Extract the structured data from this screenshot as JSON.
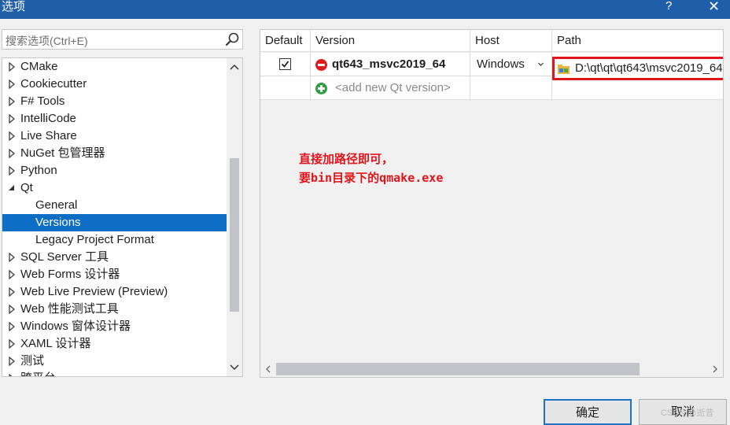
{
  "window": {
    "title": "选项",
    "help": "?",
    "close": "✕"
  },
  "search": {
    "placeholder": "搜索选项(Ctrl+E)"
  },
  "tree": {
    "items": [
      {
        "label": "CMake",
        "expanded": false
      },
      {
        "label": "Cookiecutter",
        "expanded": false
      },
      {
        "label": "F# Tools",
        "expanded": false
      },
      {
        "label": "IntelliCode",
        "expanded": false
      },
      {
        "label": "Live Share",
        "expanded": false
      },
      {
        "label": "NuGet 包管理器",
        "expanded": false
      },
      {
        "label": "Python",
        "expanded": false
      },
      {
        "label": "Qt",
        "expanded": true
      },
      {
        "label": "General",
        "child": true
      },
      {
        "label": "Versions",
        "child": true,
        "selected": true
      },
      {
        "label": "Legacy Project Format",
        "child": true
      },
      {
        "label": "SQL Server 工具",
        "expanded": false
      },
      {
        "label": "Web Forms 设计器",
        "expanded": false
      },
      {
        "label": "Web Live Preview (Preview)",
        "expanded": false
      },
      {
        "label": "Web 性能测试工具",
        "expanded": false
      },
      {
        "label": "Windows 窗体设计器",
        "expanded": false
      },
      {
        "label": "XAML 设计器",
        "expanded": false
      },
      {
        "label": "测试",
        "expanded": false
      },
      {
        "label": "跨平台",
        "expanded": false
      }
    ]
  },
  "grid": {
    "headers": {
      "default": "Default",
      "version": "Version",
      "host": "Host",
      "path": "Path"
    },
    "row": {
      "version": "qt643_msvc2019_64",
      "host": "Windows",
      "path": "D:\\qt\\qt\\qt643\\msvc2019_64"
    },
    "add_row": "<add new Qt version>"
  },
  "annotation": {
    "line1": "直接加路径即可，",
    "line2": "要bin目录下的qmake.exe"
  },
  "buttons": {
    "ok": "确定",
    "cancel": "取消"
  },
  "watermark": "CSDN @逝昔",
  "colors": {
    "titlebar": "#1f5fa9",
    "selection": "#0e6dc4",
    "highlight": "#e0141b",
    "add": "#2ea043",
    "remove": "#e01b1b"
  }
}
